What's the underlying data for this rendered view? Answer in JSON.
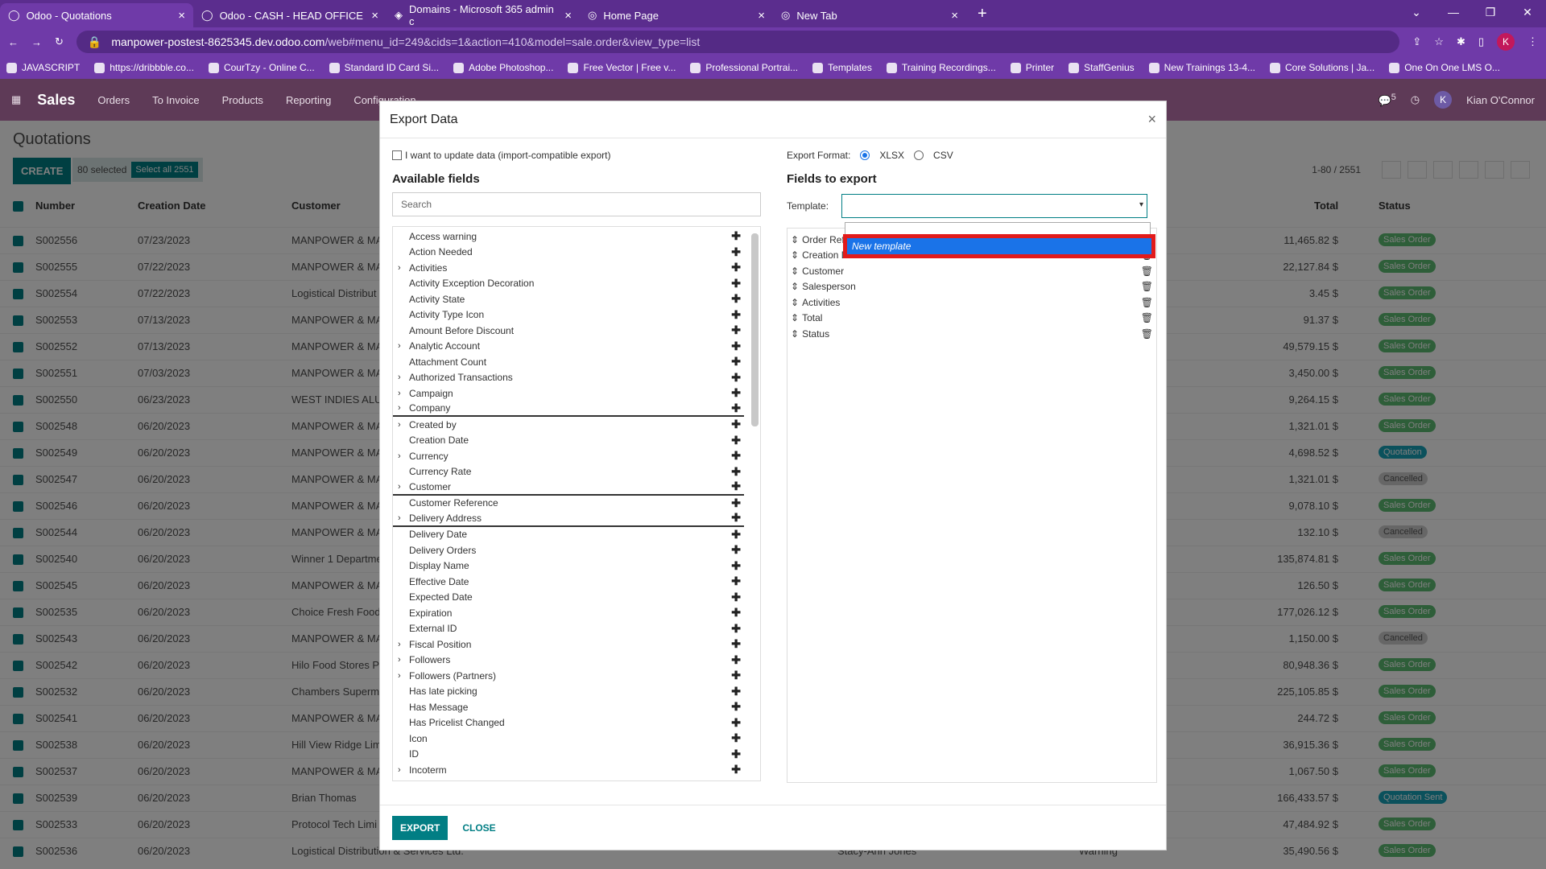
{
  "browser": {
    "tabs": [
      {
        "title": "Odoo - Quotations"
      },
      {
        "title": "Odoo - CASH - HEAD OFFICE"
      },
      {
        "title": "Domains - Microsoft 365 admin c"
      },
      {
        "title": "Home Page"
      },
      {
        "title": "New Tab"
      }
    ],
    "url_host": "manpower-postest-8625345.dev.odoo.com",
    "url_rest": "/web#menu_id=249&cids=1&action=410&model=sale.order&view_type=list",
    "bookmarks": [
      "JAVASCRIPT",
      "https://dribbble.co...",
      "CourTzy - Online C...",
      "Standard ID Card Si...",
      "Adobe Photoshop...",
      "Free Vector | Free v...",
      "Professional Portrai...",
      "Templates",
      "Training Recordings...",
      "Printer",
      "StaffGenius",
      "New Trainings 13-4...",
      "Core Solutions | Ja...",
      "One On One LMS O..."
    ]
  },
  "odoo": {
    "app": "Sales",
    "menu": [
      "Orders",
      "To Invoice",
      "Products",
      "Reporting",
      "Configuration"
    ],
    "chat_count": "5",
    "avatar_letter": "K",
    "user": "Kian O'Connor",
    "page_title": "Quotations",
    "create_label": "CREATE",
    "selected": "80 selected",
    "select_all": "Select all 2551",
    "pager": "1-80 / 2551",
    "columns": {
      "number": "Number",
      "creation_date": "Creation Date",
      "customer": "Customer",
      "total": "Total",
      "status": "Status"
    },
    "rows": [
      {
        "num": "S002556",
        "date": "07/23/2023",
        "cust": "MANPOWER & MA",
        "total": "11,465.82 $",
        "status": "Sales Order"
      },
      {
        "num": "S002555",
        "date": "07/22/2023",
        "cust": "MANPOWER & MA",
        "total": "22,127.84 $",
        "status": "Sales Order"
      },
      {
        "num": "S002554",
        "date": "07/22/2023",
        "cust": "Logistical Distribut",
        "total": "3.45 $",
        "status": "Sales Order"
      },
      {
        "num": "S002553",
        "date": "07/13/2023",
        "cust": "MANPOWER & MA",
        "total": "91.37 $",
        "status": "Sales Order"
      },
      {
        "num": "S002552",
        "date": "07/13/2023",
        "cust": "MANPOWER & MA",
        "total": "49,579.15 $",
        "status": "Sales Order"
      },
      {
        "num": "S002551",
        "date": "07/03/2023",
        "cust": "MANPOWER & MA",
        "total": "3,450.00 $",
        "status": "Sales Order"
      },
      {
        "num": "S002550",
        "date": "06/23/2023",
        "cust": "WEST INDIES ALUM",
        "total": "9,264.15 $",
        "status": "Sales Order"
      },
      {
        "num": "S002548",
        "date": "06/20/2023",
        "cust": "MANPOWER & MA",
        "total": "1,321.01 $",
        "status": "Sales Order"
      },
      {
        "num": "S002549",
        "date": "06/20/2023",
        "cust": "MANPOWER & MA",
        "total": "4,698.52 $",
        "status": "Quotation"
      },
      {
        "num": "S002547",
        "date": "06/20/2023",
        "cust": "MANPOWER & MA",
        "total": "1,321.01 $",
        "status": "Cancelled"
      },
      {
        "num": "S002546",
        "date": "06/20/2023",
        "cust": "MANPOWER & MA",
        "total": "9,078.10 $",
        "status": "Sales Order"
      },
      {
        "num": "S002544",
        "date": "06/20/2023",
        "cust": "MANPOWER & MA",
        "total": "132.10 $",
        "status": "Cancelled"
      },
      {
        "num": "S002540",
        "date": "06/20/2023",
        "cust": "Winner 1 Departme",
        "total": "135,874.81 $",
        "status": "Sales Order"
      },
      {
        "num": "S002545",
        "date": "06/20/2023",
        "cust": "MANPOWER & MA",
        "total": "126.50 $",
        "status": "Sales Order"
      },
      {
        "num": "S002535",
        "date": "06/20/2023",
        "cust": "Choice Fresh Food",
        "total": "177,026.12 $",
        "status": "Sales Order"
      },
      {
        "num": "S002543",
        "date": "06/20/2023",
        "cust": "MANPOWER & MA",
        "total": "1,150.00 $",
        "status": "Cancelled"
      },
      {
        "num": "S002542",
        "date": "06/20/2023",
        "cust": "Hilo Food Stores P",
        "total": "80,948.36 $",
        "status": "Sales Order"
      },
      {
        "num": "S002532",
        "date": "06/20/2023",
        "cust": "Chambers Superm",
        "total": "225,105.85 $",
        "status": "Sales Order"
      },
      {
        "num": "S002541",
        "date": "06/20/2023",
        "cust": "MANPOWER & MA",
        "total": "244.72 $",
        "status": "Sales Order"
      },
      {
        "num": "S002538",
        "date": "06/20/2023",
        "cust": "Hill View Ridge Lim",
        "total": "36,915.36 $",
        "status": "Sales Order"
      },
      {
        "num": "S002537",
        "date": "06/20/2023",
        "cust": "MANPOWER & MA",
        "total": "1,067.50 $",
        "status": "Sales Order"
      },
      {
        "num": "S002539",
        "date": "06/20/2023",
        "cust": "Brian Thomas",
        "total": "166,433.57 $",
        "status": "Quotation Sent"
      },
      {
        "num": "S002533",
        "date": "06/20/2023",
        "cust": "Protocol Tech Limi",
        "total": "47,484.92 $",
        "status": "Sales Order"
      },
      {
        "num": "S002536",
        "date": "06/20/2023",
        "cust": "Logistical Distribution & Services Ltd.",
        "total": "35,490.56 $",
        "status": "Sales Order",
        "salesperson": "Stacy-Ann Jones",
        "activity": "Warning"
      }
    ]
  },
  "modal": {
    "title": "Export Data",
    "update_label": "I want to update data (import-compatible export)",
    "available_title": "Available fields",
    "search_placeholder": "Search",
    "export_format_label": "Export Format:",
    "xlsx": "XLSX",
    "csv": "CSV",
    "fields_to_export_title": "Fields to export",
    "template_label": "Template:",
    "new_template": "New template",
    "available_fields": [
      {
        "label": "Access warning",
        "exp": false,
        "hl": false
      },
      {
        "label": "Action Needed",
        "exp": false,
        "hl": false
      },
      {
        "label": "Activities",
        "exp": true,
        "hl": false
      },
      {
        "label": "Activity Exception Decoration",
        "exp": false,
        "hl": false
      },
      {
        "label": "Activity State",
        "exp": false,
        "hl": false
      },
      {
        "label": "Activity Type Icon",
        "exp": false,
        "hl": false
      },
      {
        "label": "Amount Before Discount",
        "exp": false,
        "hl": false
      },
      {
        "label": "Analytic Account",
        "exp": true,
        "hl": false
      },
      {
        "label": "Attachment Count",
        "exp": false,
        "hl": false
      },
      {
        "label": "Authorized Transactions",
        "exp": true,
        "hl": false
      },
      {
        "label": "Campaign",
        "exp": true,
        "hl": false
      },
      {
        "label": "Company",
        "exp": true,
        "hl": true
      },
      {
        "label": "Created by",
        "exp": true,
        "hl": false
      },
      {
        "label": "Creation Date",
        "exp": false,
        "hl": false
      },
      {
        "label": "Currency",
        "exp": true,
        "hl": false
      },
      {
        "label": "Currency Rate",
        "exp": false,
        "hl": false
      },
      {
        "label": "Customer",
        "exp": true,
        "hl": true
      },
      {
        "label": "Customer Reference",
        "exp": false,
        "hl": false
      },
      {
        "label": "Delivery Address",
        "exp": true,
        "hl": true
      },
      {
        "label": "Delivery Date",
        "exp": false,
        "hl": false
      },
      {
        "label": "Delivery Orders",
        "exp": false,
        "hl": false
      },
      {
        "label": "Display Name",
        "exp": false,
        "hl": false
      },
      {
        "label": "Effective Date",
        "exp": false,
        "hl": false
      },
      {
        "label": "Expected Date",
        "exp": false,
        "hl": false
      },
      {
        "label": "Expiration",
        "exp": false,
        "hl": false
      },
      {
        "label": "External ID",
        "exp": false,
        "hl": false
      },
      {
        "label": "Fiscal Position",
        "exp": true,
        "hl": false
      },
      {
        "label": "Followers",
        "exp": true,
        "hl": false
      },
      {
        "label": "Followers (Partners)",
        "exp": true,
        "hl": false
      },
      {
        "label": "Has late picking",
        "exp": false,
        "hl": false
      },
      {
        "label": "Has Message",
        "exp": false,
        "hl": false
      },
      {
        "label": "Has Pricelist Changed",
        "exp": false,
        "hl": false
      },
      {
        "label": "Icon",
        "exp": false,
        "hl": false
      },
      {
        "label": "ID",
        "exp": false,
        "hl": false
      },
      {
        "label": "Incoterm",
        "exp": true,
        "hl": false
      }
    ],
    "export_fields": [
      "Order Refe",
      "Creation Date",
      "Customer",
      "Salesperson",
      "Activities",
      "Total",
      "Status"
    ],
    "export_btn": "EXPORT",
    "close_btn": "CLOSE"
  }
}
